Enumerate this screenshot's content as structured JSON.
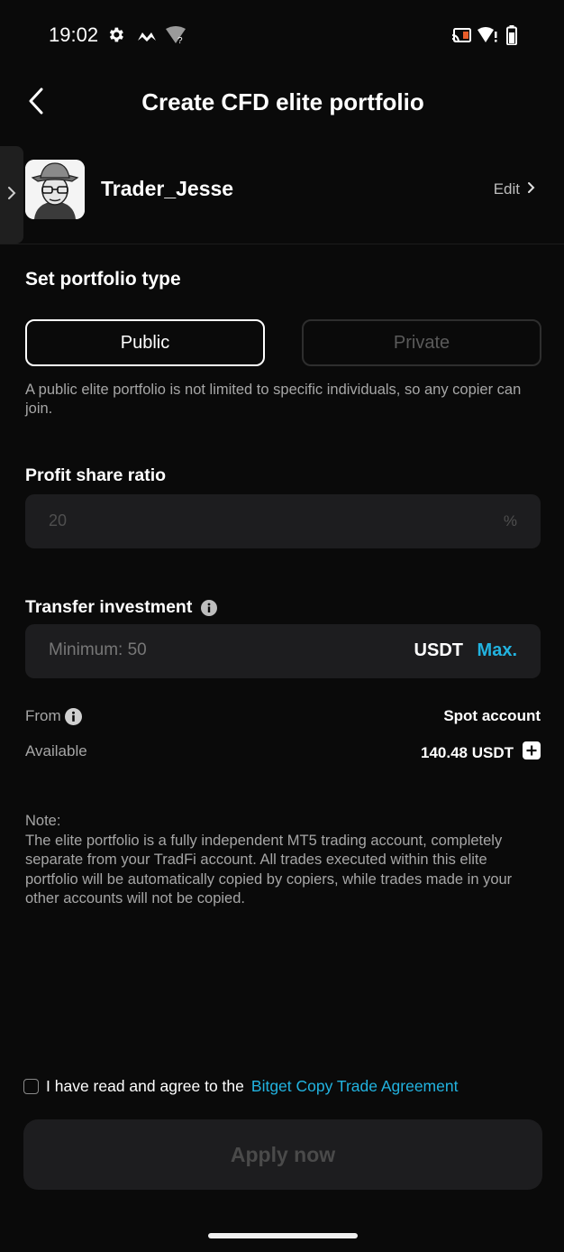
{
  "status_bar": {
    "time": "19:02",
    "icons": [
      "gear-icon",
      "game-controller-icon",
      "wifi-unknown-icon",
      "cast-icon",
      "wifi-alert-icon",
      "battery-icon"
    ]
  },
  "header": {
    "title": "Create CFD elite portfolio",
    "back_icon": "chevron-left-icon"
  },
  "profile": {
    "username": "Trader_Jesse",
    "edit_label": "Edit"
  },
  "portfolio_type": {
    "title": "Set portfolio type",
    "options": [
      "Public",
      "Private"
    ],
    "selected": "Public",
    "hint": "A public elite portfolio is not limited to specific individuals, so any copier can join."
  },
  "profit_share": {
    "title": "Profit share ratio",
    "value": "20",
    "suffix": "%"
  },
  "investment": {
    "title": "Transfer investment",
    "placeholder": "Minimum: 50",
    "currency": "USDT",
    "max_label": "Max."
  },
  "account": {
    "from_label": "From",
    "from_value": "Spot account",
    "available_label": "Available",
    "available_value": "140.48 USDT"
  },
  "note": {
    "label": "Note:",
    "text": "The elite portfolio is a fully independent MT5 trading account, completely separate from your TradFi account. All trades executed within this elite portfolio will be automatically copied by copiers, while trades made in your other accounts will not be copied."
  },
  "agreement": {
    "prefix": "I have read and agree to the",
    "link": "Bitget Copy Trade Agreement",
    "checked": false
  },
  "apply_button": "Apply now",
  "colors": {
    "background": "#0a0a0a",
    "accent": "#22b3e0",
    "input_bg": "#1d1d1f",
    "muted_text": "#a6a6a6"
  }
}
